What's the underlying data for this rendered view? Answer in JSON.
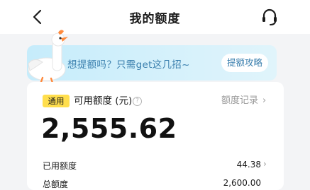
{
  "header": {
    "title": "我的额度",
    "back_icon": "chevron-left-icon",
    "service_icon": "headset-icon"
  },
  "banner": {
    "text": "想提额吗？只需get这几招~",
    "button_label": "提额攻略",
    "mascot_icon": "goose-mascot-icon"
  },
  "quota": {
    "badge": "通用",
    "label": "可用额度 (元)",
    "help_glyph": "?",
    "history_link": "额度记录",
    "history_chevron": "›",
    "available_amount": "2,555.62"
  },
  "details": [
    {
      "label": "已用额度",
      "value": "44.38",
      "chevron": "›"
    },
    {
      "label": "总额度",
      "value": "2,600.00"
    }
  ],
  "colors": {
    "badge_bg": "#ffde4d",
    "banner_text": "#3a7fae",
    "page_bg": "#f3f4f6"
  }
}
